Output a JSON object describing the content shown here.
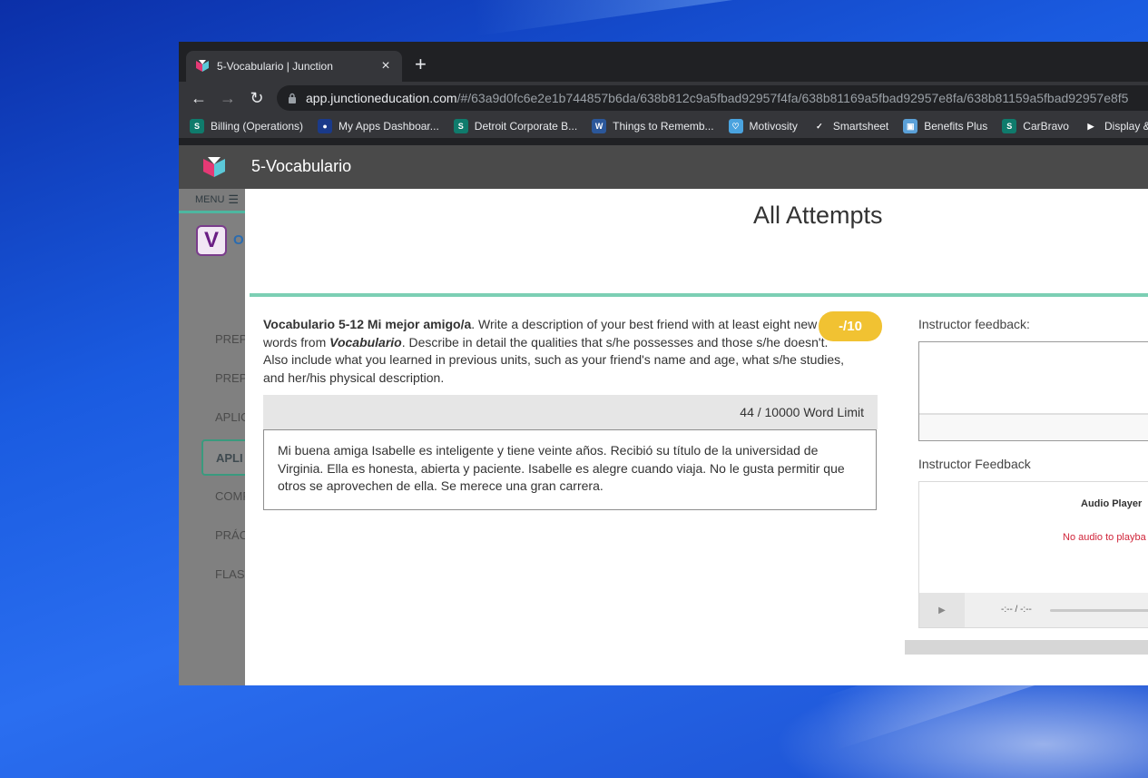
{
  "browser": {
    "tab_title": "5-Vocabulario | Junction",
    "tab_close": "×",
    "new_tab": "+",
    "url_host": "app.junctioneducation.com",
    "url_path": "/#/63a9d0fc6e2e1b744857b6da/638b812c9a5fbad92957f4fa/638b81169a5fbad92957e8fa/638b81159a5fbad92957e8f5",
    "bookmarks": [
      {
        "label": "Billing (Operations)",
        "icon": "sharepoint-icon",
        "color": "#0f7b6c",
        "glyph": "S"
      },
      {
        "label": "My Apps Dashboar...",
        "icon": "myapps-icon",
        "color": "#1a3a8a",
        "glyph": "●"
      },
      {
        "label": "Detroit Corporate B...",
        "icon": "sharepoint-icon",
        "color": "#0f7b6c",
        "glyph": "S"
      },
      {
        "label": "Things to Rememb...",
        "icon": "word-icon",
        "color": "#2b579a",
        "glyph": "W"
      },
      {
        "label": "Motivosity",
        "icon": "motivosity-icon",
        "color": "#4aa3df",
        "glyph": "♡"
      },
      {
        "label": "Smartsheet",
        "icon": "smartsheet-icon",
        "color": "#35363a",
        "glyph": "✓"
      },
      {
        "label": "Benefits Plus",
        "icon": "benefits-icon",
        "color": "#5aa0d8",
        "glyph": "▣"
      },
      {
        "label": "CarBravo",
        "icon": "sharepoint-icon",
        "color": "#0f7b6c",
        "glyph": "S"
      },
      {
        "label": "Display &",
        "icon": "display-icon",
        "color": "#35363a",
        "glyph": "▶"
      }
    ]
  },
  "app": {
    "title": "5-Vocabulario",
    "menu_label": "MENU",
    "brand_fragment": "O",
    "sidebar_items": [
      "PREP",
      "PREP",
      "APLIC",
      "COMP",
      "PRÁC",
      "FLAS"
    ],
    "sidebar_active": "APLI"
  },
  "modal": {
    "title": "All Attempts",
    "prompt_bold": "Vocabulario 5-12 Mi mejor amigo/a",
    "prompt_part1": ". Write a description of your best friend with at least eight new words from ",
    "prompt_italic": "Vocabulario",
    "prompt_part2": ". Describe in detail the qualities that s/he possesses and those s/he doesn't. Also include what you learned in previous units, such as your friend's name and age, what s/he studies, and her/his physical description.",
    "score": "-/10",
    "word_count": "44 /  10000 Word Limit",
    "response_text": "Mi buena amiga Isabelle es inteligente y tiene veinte años. Recibió su título de la universidad de Virginia. Ella es honesta, abierta y paciente. Isabelle es alegre cuando viaja. No le gusta permitir que otros se aprovechen de ella. Se merece una gran carrera.",
    "feedback_label_text": "Instructor feedback:",
    "feedback_label_audio": "Instructor Feedback",
    "audio_player_title": "Audio Player",
    "audio_player_message": "No audio to playba",
    "audio_time": "-:-- / -:--"
  },
  "colors": {
    "accent": "#7ccfb4",
    "score_badge": "#f1c232",
    "error_text": "#d0253a"
  }
}
